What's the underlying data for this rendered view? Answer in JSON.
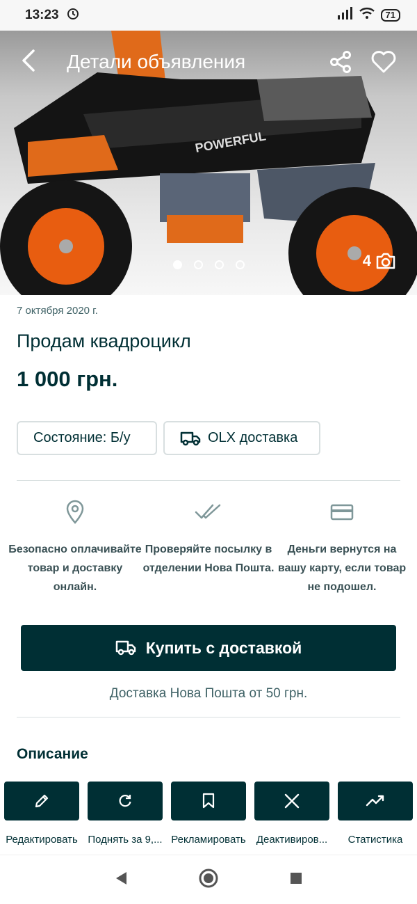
{
  "status_bar": {
    "time": "13:23",
    "battery": "71"
  },
  "header": {
    "title": "Детали объявления"
  },
  "gallery": {
    "photo_count": "4",
    "dots": 4,
    "active_dot": 0
  },
  "ad": {
    "date": "7 октября 2020 г.",
    "title": "Продам квадроцикл",
    "price": "1 000 грн."
  },
  "chips": {
    "condition": "Состояние: Б/у",
    "delivery": "OLX доставка"
  },
  "benefits": [
    {
      "icon": "location-pin-icon",
      "text": "Безопасно оплачивайте товар и доставку онлайн."
    },
    {
      "icon": "double-check-icon",
      "text": "Проверяйте посылку в отделении Нова Пошта."
    },
    {
      "icon": "card-icon",
      "text": "Деньги вернутся на вашу карту, если товар не подошел."
    }
  ],
  "buy": {
    "label": "Купить с доставкой",
    "note": "Доставка Нова Пошта от 50 грн."
  },
  "description": {
    "title": "Описание"
  },
  "actions": [
    {
      "icon": "pencil-icon",
      "label": "Редактировать"
    },
    {
      "icon": "refresh-icon",
      "label": "Поднять за 9,..."
    },
    {
      "icon": "bookmark-icon",
      "label": "Рекламировать"
    },
    {
      "icon": "close-icon",
      "label": "Деактивиров..."
    },
    {
      "icon": "trend-icon",
      "label": "Статистика"
    }
  ],
  "colors": {
    "primary": "#002f34",
    "muted": "#406367",
    "border": "#d8dfe0"
  }
}
